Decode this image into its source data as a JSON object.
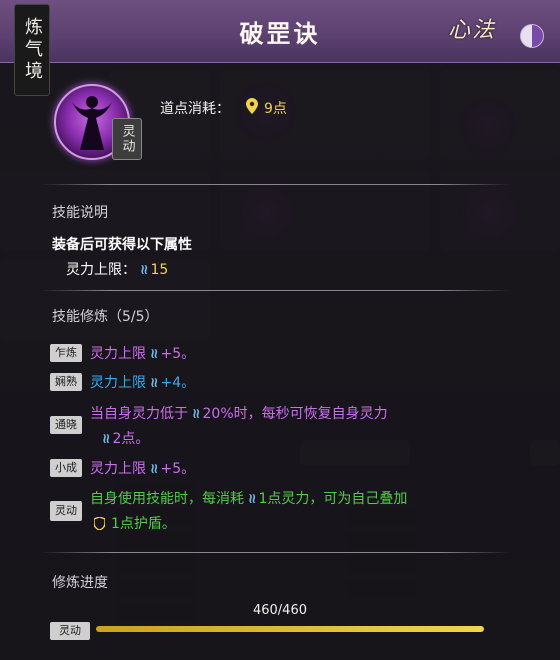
{
  "realm": "炼气境",
  "title": "破罡诀",
  "header_badge": "心法",
  "skill": {
    "tag": "灵动",
    "cost_label": "道点消耗：",
    "cost_value": "9点"
  },
  "sections": {
    "description_title": "技能说明",
    "attr_intro": "装备后可获得以下属性",
    "attr_label": "灵力上限：",
    "attr_value": "15",
    "practice_title": "技能修炼（5/5）"
  },
  "practice_tiers": [
    {
      "tier": "乍炼",
      "text": "灵力上限",
      "value": "+5。",
      "color": "purple"
    },
    {
      "tier": "娴熟",
      "text": "灵力上限",
      "value": "+4。",
      "color": "blue"
    },
    {
      "tier": "通晓",
      "line1_pre": "当自身灵力低于",
      "line1_post": "20%时，每秒可恢复自身灵力",
      "line2": "2点。",
      "color": "purple"
    },
    {
      "tier": "小成",
      "text": "灵力上限",
      "value": "+5。",
      "color": "purple"
    },
    {
      "tier": "灵动",
      "line1_pre": "自身使用技能时，每消耗",
      "line1_post": "1点灵力，可为自己叠加",
      "line2": "1点护盾。",
      "color": "green"
    }
  ],
  "progress": {
    "label": "修炼进度",
    "text": "460/460",
    "tag": "灵动",
    "current": 460,
    "max": 460
  },
  "colors": {
    "purple": "#cc6ef0",
    "blue": "#3ba9f2",
    "green": "#52cc4a",
    "gold": "#f1d44a",
    "header": "#5b4070"
  },
  "icons": [
    "skill-figure-icon",
    "location-pin-icon",
    "spirit-wave-icon",
    "shield-icon",
    "taiji-icon"
  ]
}
